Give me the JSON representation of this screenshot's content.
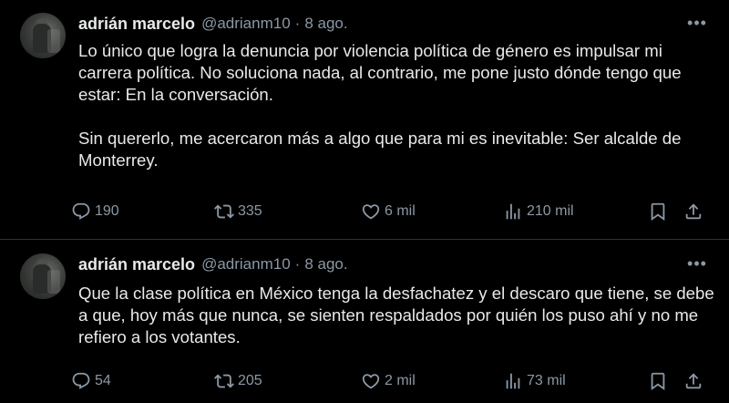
{
  "tweets": [
    {
      "author": {
        "name": "adrián marcelo",
        "handle": "@adrianm10",
        "separator": "·",
        "date": "8 ago."
      },
      "paragraphs": [
        "Lo único que logra la denuncia por violencia política de género es impulsar mi carrera política. No soluciona nada, al contrario, me pone justo dónde tengo que estar: En la conversación.",
        "Sin quererlo, me acercaron más a algo que para mi es inevitable: Ser alcalde de Monterrey."
      ],
      "stats": {
        "replies": "190",
        "retweets": "335",
        "likes": "6 mil",
        "views": "210 mil"
      }
    },
    {
      "author": {
        "name": "adrián marcelo",
        "handle": "@adrianm10",
        "separator": "·",
        "date": "8 ago."
      },
      "paragraphs": [
        "Que la clase política en México tenga la desfachatez y el descaro que tiene, se debe a que, hoy más que nunca, se sienten respaldados por quién los puso ahí y no me refiero a los votantes."
      ],
      "stats": {
        "replies": "54",
        "retweets": "205",
        "likes": "2 mil",
        "views": "73 mil"
      }
    }
  ],
  "icons": {
    "more": "more-horizontal-icon",
    "reply": "reply-icon",
    "retweet": "retweet-icon",
    "like": "heart-icon",
    "views": "analytics-icon",
    "bookmark": "bookmark-icon",
    "share": "share-icon"
  },
  "colors": {
    "background": "#000000",
    "text": "#e7e9ea",
    "secondary": "#8b98a5",
    "divider": "#2f3336"
  }
}
